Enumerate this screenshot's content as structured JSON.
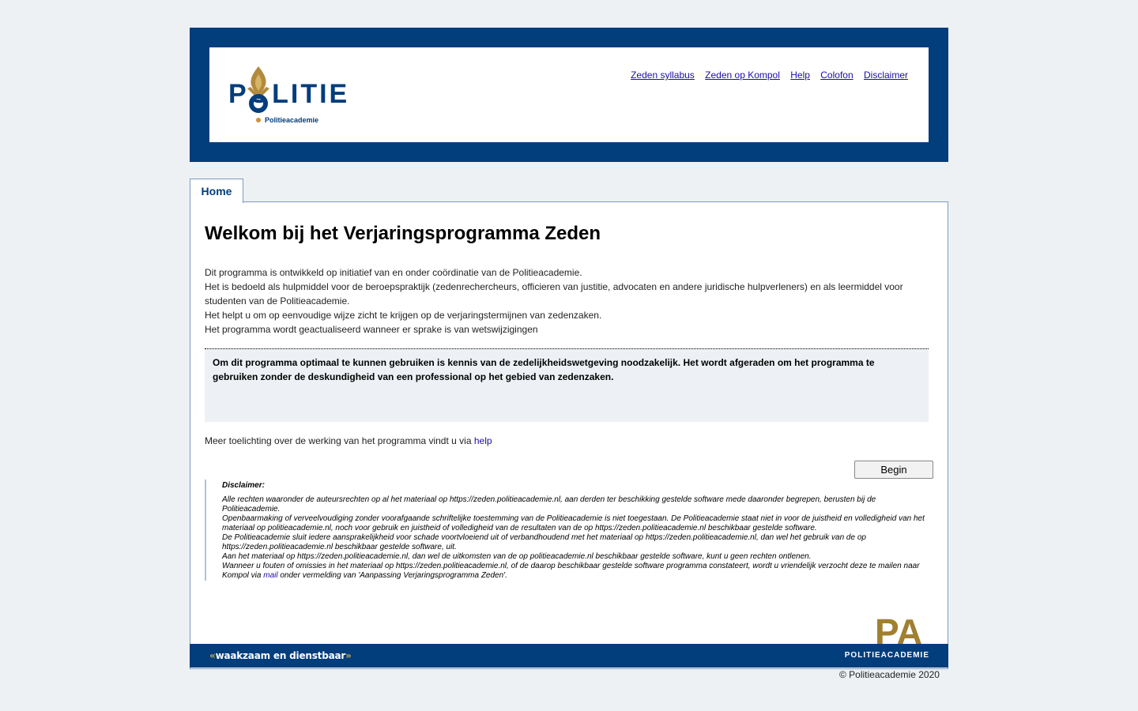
{
  "header": {
    "logo": {
      "brand": "POLITIE",
      "sub": "Politieacademie"
    },
    "links": [
      "Zeden syllabus",
      "Zeden op Kompol",
      "Help",
      "Colofon",
      "Disclaimer"
    ]
  },
  "tabs": {
    "home": "Home"
  },
  "main": {
    "title": "Welkom bij het Verjaringsprogramma Zeden",
    "intro": [
      "Dit programma is ontwikkeld op initiatief van en onder coördinatie van de Politieacademie.",
      "Het is bedoeld als hulpmiddel voor de beroepspraktijk (zedenrechercheurs, officieren van justitie, advocaten en andere juridische hulpverleners) en als leermiddel voor studenten van de Politieacademie.",
      "Het helpt u om op eenvoudige wijze zicht te krijgen op de verjaringstermijnen van zedenzaken.",
      "Het programma wordt geactualiseerd wanneer er sprake is van wetswijzigingen"
    ],
    "warning": "Om dit programma optimaal te kunnen gebruiken is kennis van de zedelijkheidswetgeving noodzakelijk. Het wordt afgeraden om het programma te gebruiken zonder de deskundigheid van een professional op het gebied van zedenzaken.",
    "more_text": "Meer toelichting over de werking van het programma vindt u via ",
    "more_link": "help",
    "begin_button": "Begin"
  },
  "disclaimer": {
    "title": "Disclaimer:",
    "p1": "Alle rechten waaronder de auteursrechten op al het materiaal op https://zeden.politieacademie.nl, aan derden ter beschikking gestelde software mede daaronder begrepen, berusten bij de Politieacademie.",
    "p2": "Openbaarmaking of verveelvoudiging zonder voorafgaande schriftelijke toestemming van de Politieacademie is niet toegestaan. De Politieacademie staat niet in voor de juistheid en volledigheid van het materiaal op politieacademie.nl, noch voor gebruik en juistheid of volledigheid van de resultaten van de op https://zeden.politieacademie.nl beschikbaar gestelde software.",
    "p3": "De Politieacademie sluit iedere aansprakelijkheid voor schade voortvloeiend uit of verbandhoudend met het materiaal op https://zeden.politieacademie.nl, dan wel het gebruik van de op https://zeden.politieacademie.nl beschikbaar gestelde software, uit.",
    "p4": "Aan het materiaal op https://zeden.politieacademie.nl, dan wel de uitkomsten van de op politieacademie.nl beschikbaar gestelde software, kunt u geen rechten ontlenen.",
    "p5_before": "Wanneer u fouten of omissies in het materiaal op https://zeden.politieacademie.nl, of de daarop beschikbaar gestelde software programma constateert, wordt u vriendelijk verzocht deze te mailen naar Kompol via ",
    "p5_link": "mail",
    "p5_after": " onder vermelding van 'Aanpassing Verjaringsprogramma Zeden'."
  },
  "footer": {
    "slogan_open": "«",
    "slogan": "waakzaam en dienstbaar",
    "slogan_close": "»",
    "pa_letters": "PA",
    "pa_word": "POLITIEACADEMIE",
    "copyright": "© Politieacademie 2020"
  },
  "colors": {
    "navy": "#023d7c",
    "gold": "#a08030"
  }
}
